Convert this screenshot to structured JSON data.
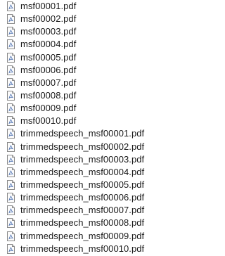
{
  "file_list": {
    "items": [
      {
        "name": "msf00001.pdf",
        "icon": "pdf-document-icon"
      },
      {
        "name": "msf00002.pdf",
        "icon": "pdf-document-icon"
      },
      {
        "name": "msf00003.pdf",
        "icon": "pdf-document-icon"
      },
      {
        "name": "msf00004.pdf",
        "icon": "pdf-document-icon"
      },
      {
        "name": "msf00005.pdf",
        "icon": "pdf-document-icon"
      },
      {
        "name": "msf00006.pdf",
        "icon": "pdf-document-icon"
      },
      {
        "name": "msf00007.pdf",
        "icon": "pdf-document-icon"
      },
      {
        "name": "msf00008.pdf",
        "icon": "pdf-document-icon"
      },
      {
        "name": "msf00009.pdf",
        "icon": "pdf-document-icon"
      },
      {
        "name": "msf00010.pdf",
        "icon": "pdf-document-icon"
      },
      {
        "name": "trimmedspeech_msf00001.pdf",
        "icon": "pdf-document-icon"
      },
      {
        "name": "trimmedspeech_msf00002.pdf",
        "icon": "pdf-document-icon"
      },
      {
        "name": "trimmedspeech_msf00003.pdf",
        "icon": "pdf-document-icon"
      },
      {
        "name": "trimmedspeech_msf00004.pdf",
        "icon": "pdf-document-icon"
      },
      {
        "name": "trimmedspeech_msf00005.pdf",
        "icon": "pdf-document-icon"
      },
      {
        "name": "trimmedspeech_msf00006.pdf",
        "icon": "pdf-document-icon"
      },
      {
        "name": "trimmedspeech_msf00007.pdf",
        "icon": "pdf-document-icon"
      },
      {
        "name": "trimmedspeech_msf00008.pdf",
        "icon": "pdf-document-icon"
      },
      {
        "name": "trimmedspeech_msf00009.pdf",
        "icon": "pdf-document-icon"
      },
      {
        "name": "trimmedspeech_msf00010.pdf",
        "icon": "pdf-document-icon"
      }
    ]
  }
}
